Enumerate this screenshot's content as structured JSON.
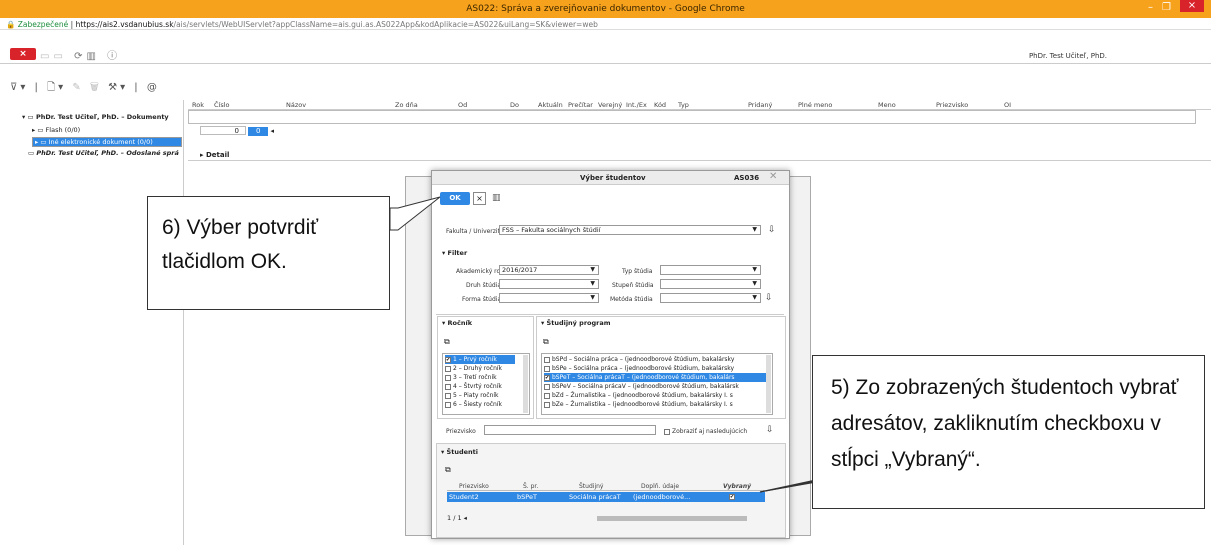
{
  "window": {
    "title": "AS022: Správa a zverejňovanie dokumentov - Google Chrome",
    "controls": [
      "–",
      "❐",
      "×"
    ]
  },
  "address": {
    "secure": "Zabezpečené",
    "host": "https://ais2.vsdanubius.sk",
    "path": "/ais/servlets/WebUIServlet?appClassName=ais.gui.as.AS022App&kodAplikacie=AS022&uiLang=SK&viewer=web"
  },
  "toolbar": {
    "close_label": "×",
    "user": "PhDr. Test Učiteľ, PhD."
  },
  "tree": {
    "root": "PhDr. Test Učiteľ, PhD. – Dokumenty",
    "flash": "Flash (0/0)",
    "ine": "Iné elektronické dokument (0/0)",
    "odoslane": "PhDr. Test Učiteľ, PhD. – Odoslané sprá"
  },
  "grid": {
    "columns": [
      "Rok",
      "Číslo",
      "Názov",
      "Zo dňa",
      "Od",
      "Do",
      "Aktuáln",
      "Prečítar",
      "Verejný",
      "Int./Ex",
      "Kód",
      "Typ",
      "Pridaný",
      "Plné meno",
      "Meno",
      "Priezvisko",
      "OI"
    ],
    "pager_left": "0",
    "pager_right": "0"
  },
  "detail_label": "Detail",
  "dialog": {
    "title": "Výber študentov",
    "code": "AS036",
    "ok": "OK",
    "fakulta_label": "Fakulta / Univerzita",
    "fakulta_value": "FSS – Fakulta sociálnych štúdií",
    "filter": "Filter",
    "ak_rok_label": "Akademický rok",
    "ak_rok_value": "2016/2017",
    "typ_label": "Typ štúdia",
    "druh_label": "Druh štúdia",
    "stupen_label": "Stupeň štúdia",
    "forma_label": "Forma štúdia",
    "metoda_label": "Metóda štúdia",
    "rocnik_header": "Ročník",
    "program_header": "Študijný program",
    "rocniky": [
      "1 – Prvý ročník",
      "2 – Druhý ročník",
      "3 – Tretí ročník",
      "4 – Štvrtý ročník",
      "5 – Piaty ročník",
      "6 – Šiesty ročník"
    ],
    "programy": [
      "bSPd – Sociálna práca – (jednoodborové štúdium, bakalársky",
      "bSPe – Sociálna práca – (jednoodborové štúdium, bakalársky",
      "bSPeT – Sociálna prácaT – (jednoodborové štúdium, bakalárs",
      "bSPeV – Sociálna prácaV – (jednoodborové štúdium, bakalársk",
      "bZd – Žurnalistika – (jednoodborové štúdium, bakalársky I. s",
      "bZe – Žurnalistika – (jednoodborové štúdium, bakalársky I. s"
    ],
    "priezvisko_label": "Priezvisko",
    "zobrazit_label": "Zobraziť aj nasledujúcich",
    "studenti_header": "Študenti",
    "stud_cols": [
      "Priezvisko",
      "Š. pr.",
      "Študijný",
      "Doplň. údaje",
      "Vybraný"
    ],
    "student": {
      "name": "Student2",
      "pr": "bSPeT",
      "prog": "Sociálna prácaT",
      "dopl": "(jednoodborové..."
    },
    "pager": "1  /  1"
  },
  "callouts": {
    "c6": "6) Výber potvrdiť tlačidlom OK.",
    "c5": "5) Zo zobrazených študentoch vybrať adresátov, zakliknutím checkboxu v stĺpci „Vybraný“."
  }
}
